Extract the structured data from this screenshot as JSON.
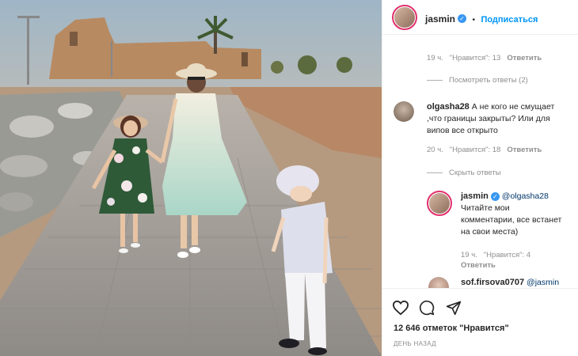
{
  "header": {
    "username": "jasmin",
    "separator": "•",
    "follow_label": "Подписаться"
  },
  "comments": [
    {
      "partial_text": "...",
      "time": "19 ч.",
      "likes": "\"Нравится\": 13",
      "reply_label": "Ответить",
      "thread_toggle": "Посмотреть ответы (2)"
    },
    {
      "username": "olgasha28",
      "text": "А не кого не смущает ,что границы закрыты? Или для випов все открыто",
      "time": "20 ч.",
      "likes": "\"Нравится\": 18",
      "reply_label": "Ответить",
      "thread_toggle": "Скрыть ответы",
      "replies": [
        {
          "username": "jasmin",
          "mention": "@olgasha28",
          "text": "Читайте мои комментарии, все встанет на свои места)",
          "time": "19 ч.",
          "likes": "\"Нравится\": 4",
          "reply_label": "Ответить"
        },
        {
          "username": "sof.firsova0707",
          "mention": "@jasmin"
        }
      ]
    }
  ],
  "actions": {
    "likes_count": "12 646 отметок \"Нравится\"",
    "date": "ДЕНЬ НАЗАД"
  },
  "colors": {
    "accent": "#0095f6",
    "verified": "#3897f0",
    "muted": "#8e8e8e"
  }
}
